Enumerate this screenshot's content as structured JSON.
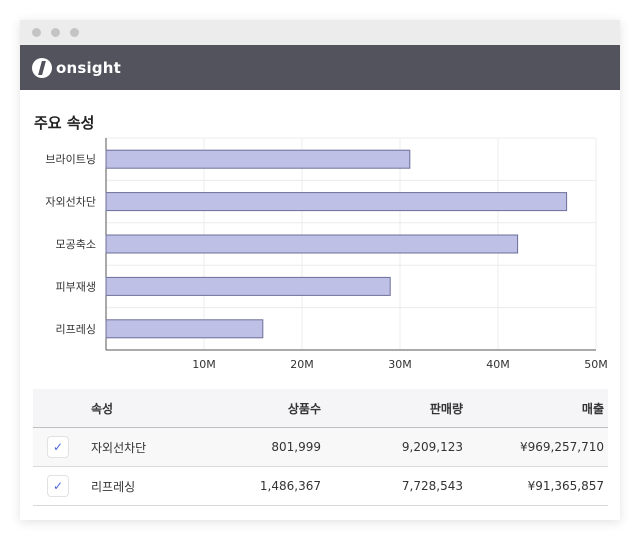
{
  "app": {
    "logo_text": "onsight"
  },
  "section": {
    "title": "주요 속성"
  },
  "chart_data": {
    "type": "bar",
    "orientation": "horizontal",
    "categories": [
      "브라이트닝",
      "자외선차단",
      "모공축소",
      "피부재생",
      "리프레싱"
    ],
    "values": [
      31,
      47,
      42,
      29,
      16
    ],
    "unit": "M",
    "xlim": [
      0,
      50
    ],
    "tick_labels": [
      "10M",
      "20M",
      "30M",
      "40M",
      "50M"
    ],
    "ticks": [
      10,
      20,
      30,
      40,
      50
    ],
    "grid": true,
    "bar_color": "#bfc0e6",
    "bar_stroke": "#6d6e9a"
  },
  "table": {
    "headers": {
      "attr": "속성",
      "products": "상품수",
      "sales_qty": "판매량",
      "revenue": "매출"
    },
    "rows": [
      {
        "checked": true,
        "attr": "자외선차단",
        "products": "801,999",
        "sales_qty": "9,209,123",
        "revenue": "¥969,257,710"
      },
      {
        "checked": true,
        "attr": "리프레싱",
        "products": "1,486,367",
        "sales_qty": "7,728,543",
        "revenue": "¥91,365,857"
      }
    ]
  },
  "icons": {
    "check": "check-icon",
    "logo": "onsight-logo-icon"
  },
  "colors": {
    "appbar": "#52535d",
    "accent": "#4a63d8"
  }
}
